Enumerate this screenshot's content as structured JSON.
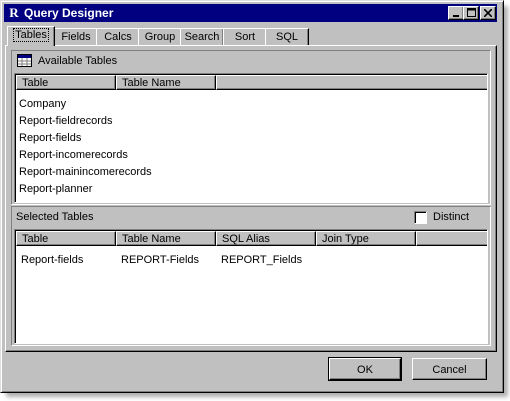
{
  "window": {
    "app_icon": "R",
    "title": "Query Designer",
    "controls": {
      "minimize": "minimize-icon",
      "maximize": "maximize-icon",
      "close": "close-icon"
    }
  },
  "tabs": [
    {
      "label": "Tables",
      "active": true
    },
    {
      "label": "Fields"
    },
    {
      "label": "Calcs"
    },
    {
      "label": "Group"
    },
    {
      "label": "Search"
    },
    {
      "label": "Sort"
    },
    {
      "label": "SQL"
    }
  ],
  "available": {
    "heading": "Available Tables",
    "icon": "table-grid-icon",
    "columns": [
      "Table",
      "Table Name"
    ],
    "rows": [
      [
        "Company",
        ""
      ],
      [
        "Report-fieldrecords",
        ""
      ],
      [
        "Report-fields",
        ""
      ],
      [
        "Report-incomerecords",
        ""
      ],
      [
        "Report-mainincomerecords",
        ""
      ],
      [
        "Report-planner",
        ""
      ]
    ]
  },
  "selected": {
    "heading": "Selected Tables",
    "distinct_label": "Distinct",
    "distinct_checked": false,
    "columns": [
      "Table",
      "Table Name",
      "SQL Alias",
      "Join Type"
    ],
    "rows": [
      [
        "Report-fields",
        "REPORT-Fields",
        "REPORT_Fields",
        ""
      ]
    ]
  },
  "buttons": {
    "ok": "OK",
    "cancel": "Cancel"
  }
}
